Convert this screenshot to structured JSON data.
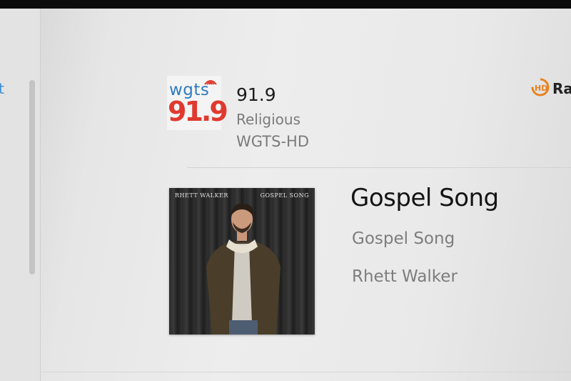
{
  "left_panel": {
    "tab_text": "t"
  },
  "station": {
    "logo_text": "wgts",
    "logo_frequency": "91.9",
    "frequency": "91.9",
    "genre": "Religious",
    "call_sign": "WGTS-HD"
  },
  "hd_radio": {
    "label": "Ra"
  },
  "album_art": {
    "artist_text": "RHETT WALKER",
    "title_text": "GOSPEL SONG"
  },
  "now_playing": {
    "title": "Gospel Song",
    "album": "Gospel Song",
    "artist": "Rhett Walker"
  },
  "colors": {
    "logo_blue": "#2e7cc0",
    "logo_red": "#e0392f",
    "hd_orange": "#e8821e"
  }
}
